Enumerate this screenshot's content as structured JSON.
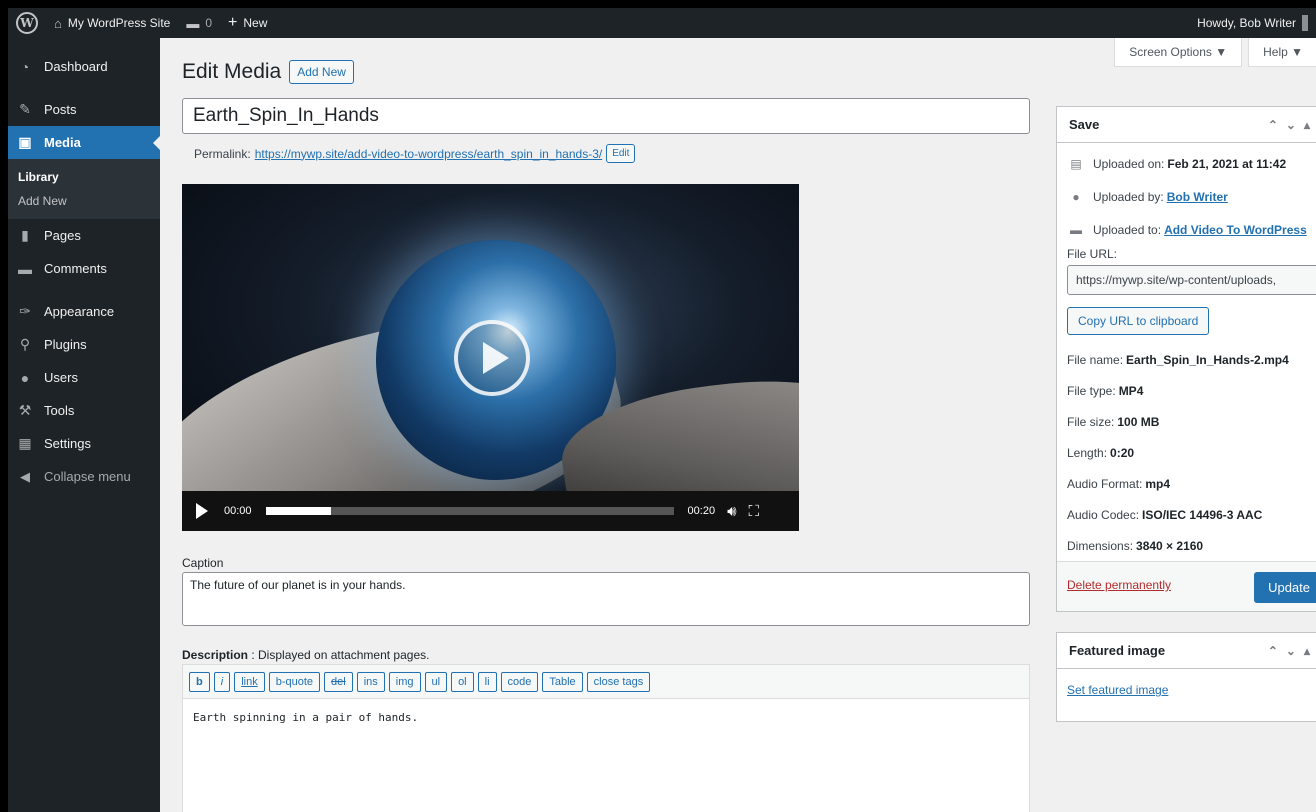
{
  "adminbar": {
    "site_name": "My WordPress Site",
    "comments_count": "0",
    "new_label": "New",
    "howdy": "Howdy, Bob Writer"
  },
  "sidebar": {
    "items": [
      {
        "label": "Dashboard",
        "icon": "dashboard-icon"
      },
      {
        "label": "Posts",
        "icon": "pin-icon"
      },
      {
        "label": "Media",
        "icon": "media-icon"
      },
      {
        "label": "Pages",
        "icon": "page-icon"
      },
      {
        "label": "Comments",
        "icon": "comment-icon"
      },
      {
        "label": "Appearance",
        "icon": "brush-icon"
      },
      {
        "label": "Plugins",
        "icon": "plugin-icon"
      },
      {
        "label": "Users",
        "icon": "user-icon"
      },
      {
        "label": "Tools",
        "icon": "wrench-icon"
      },
      {
        "label": "Settings",
        "icon": "settings-icon"
      }
    ],
    "submenu": [
      "Library",
      "Add New"
    ],
    "collapse": "Collapse menu"
  },
  "screen_meta": {
    "screen_options": "Screen Options ▼",
    "help": "Help ▼"
  },
  "header": {
    "title": "Edit Media",
    "add_new": "Add New"
  },
  "media_title": "Earth_Spin_In_Hands",
  "permalink": {
    "label": "Permalink:",
    "url": "https://mywp.site/add-video-to-wordpress/earth_spin_in_hands-3/",
    "edit": "Edit"
  },
  "video": {
    "current_time": "00:00",
    "duration": "00:20",
    "progress": 0.16
  },
  "caption": {
    "label": "Caption",
    "value": "The future of our planet is in your hands."
  },
  "description": {
    "label": "Description",
    "hint": " : Displayed on attachment pages.",
    "value": "Earth spinning in a pair of hands.",
    "buttons": [
      "b",
      "i",
      "link",
      "b-quote",
      "del",
      "ins",
      "img",
      "ul",
      "ol",
      "li",
      "code",
      "Table",
      "close tags"
    ]
  },
  "save_box": {
    "title": "Save",
    "uploaded_on_label": "Uploaded on:",
    "uploaded_on": "Feb 21, 2021 at 11:42",
    "uploaded_by_label": "Uploaded by:",
    "uploaded_by": "Bob Writer",
    "uploaded_to_label": "Uploaded to:",
    "uploaded_to": "Add Video To WordPress",
    "file_url_label": "File URL:",
    "file_url": "https://mywp.site/wp-content/uploads,",
    "copy_url": "Copy URL to clipboard",
    "file_name_label": "File name:",
    "file_name": "Earth_Spin_In_Hands-2.mp4",
    "file_type_label": "File type:",
    "file_type": "MP4",
    "file_size_label": "File size:",
    "file_size": "100 MB",
    "length_label": "Length:",
    "length": "0:20",
    "audio_format_label": "Audio Format:",
    "audio_format": "mp4",
    "audio_codec_label": "Audio Codec:",
    "audio_codec": "ISO/IEC 14496-3 AAC",
    "dimensions_label": "Dimensions:",
    "dimensions": "3840 × 2160",
    "delete": "Delete permanently",
    "update": "Update"
  },
  "featured_box": {
    "title": "Featured image",
    "set_link": "Set featured image"
  },
  "colors": {
    "accent": "#2271b1",
    "adminbar": "#1d2327",
    "delete": "#b32d2e"
  }
}
